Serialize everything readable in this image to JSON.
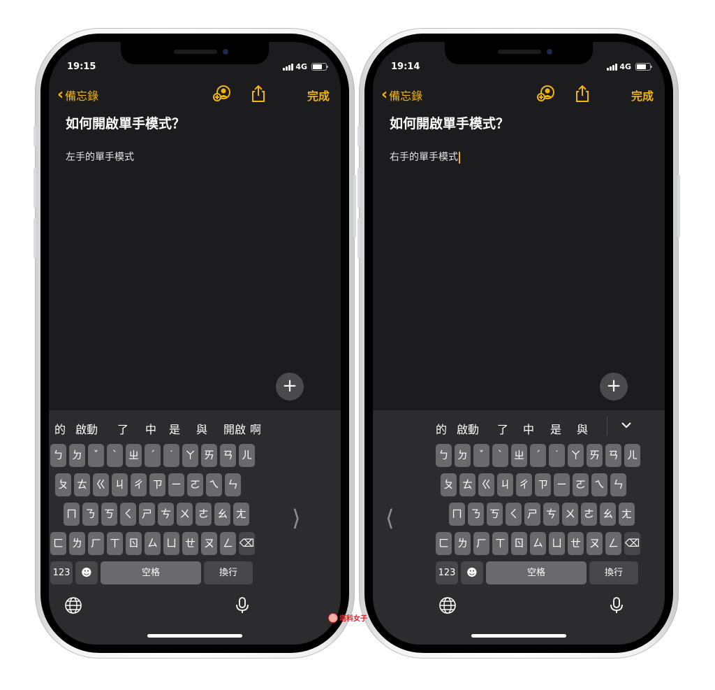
{
  "left_phone": {
    "status": {
      "time": "19:15",
      "network": "4G"
    },
    "nav": {
      "back_label": "備忘錄",
      "done_label": "完成"
    },
    "note": {
      "title": "如何開啟單手模式？",
      "body": "左手的單手模式"
    },
    "candidates": [
      "的",
      "啟動",
      "了",
      "中",
      "是",
      "與",
      "開啟",
      "啊"
    ],
    "keys": {
      "row1": [
        "ㄅ",
        "ㄉ",
        "ˇ",
        "ˋ",
        "ㄓ",
        "ˊ",
        "˙",
        "ㄚ",
        "ㄞ",
        "ㄢ",
        "ㄦ"
      ],
      "row2": [
        "ㄆ",
        "ㄊ",
        "ㄍ",
        "ㄐ",
        "ㄔ",
        "ㄗ",
        "ㄧ",
        "ㄛ",
        "ㄟ",
        "ㄣ"
      ],
      "row3": [
        "ㄇ",
        "ㄋ",
        "ㄎ",
        "ㄑ",
        "ㄕ",
        "ㄘ",
        "ㄨ",
        "ㄜ",
        "ㄠ",
        "ㄤ"
      ],
      "row4": [
        "ㄈ",
        "ㄌ",
        "ㄏ",
        "ㄒ",
        "ㄖ",
        "ㄙ",
        "ㄩ",
        "ㄝ",
        "ㄡ",
        "ㄥ"
      ],
      "num_label": "123",
      "space_label": "空格",
      "return_label": "換行",
      "delete_glyph": "⌫",
      "emoji_glyph": "☻",
      "arrow_glyph": "⟩"
    }
  },
  "right_phone": {
    "status": {
      "time": "19:14",
      "network": "4G"
    },
    "nav": {
      "back_label": "備忘錄",
      "done_label": "完成"
    },
    "note": {
      "title": "如何開啟單手模式？",
      "body": "右手的單手模式"
    },
    "candidates": [
      "的",
      "啟動",
      "了",
      "中",
      "是",
      "與"
    ],
    "collapse_glyph": "⌄",
    "keys": {
      "row1": [
        "ㄅ",
        "ㄉ",
        "ˇ",
        "ˋ",
        "ㄓ",
        "ˊ",
        "˙",
        "ㄚ",
        "ㄞ",
        "ㄢ",
        "ㄦ"
      ],
      "row2": [
        "ㄆ",
        "ㄊ",
        "ㄍ",
        "ㄐ",
        "ㄔ",
        "ㄗ",
        "ㄧ",
        "ㄛ",
        "ㄟ",
        "ㄣ"
      ],
      "row3": [
        "ㄇ",
        "ㄋ",
        "ㄎ",
        "ㄑ",
        "ㄕ",
        "ㄘ",
        "ㄨ",
        "ㄜ",
        "ㄠ",
        "ㄤ"
      ],
      "row4": [
        "ㄈ",
        "ㄌ",
        "ㄏ",
        "ㄒ",
        "ㄖ",
        "ㄙ",
        "ㄩ",
        "ㄝ",
        "ㄡ",
        "ㄥ"
      ],
      "num_label": "123",
      "space_label": "空格",
      "return_label": "換行",
      "delete_glyph": "⌫",
      "emoji_glyph": "☻",
      "arrow_glyph": "⟨"
    }
  },
  "shared": {
    "fab_glyph": "+"
  },
  "watermark": {
    "text": "塔科女子"
  },
  "colors": {
    "accent": "#f2b705",
    "background": "#1c1c1e",
    "keyboard": "#2c2c2e",
    "key": "#6a6a6e"
  }
}
